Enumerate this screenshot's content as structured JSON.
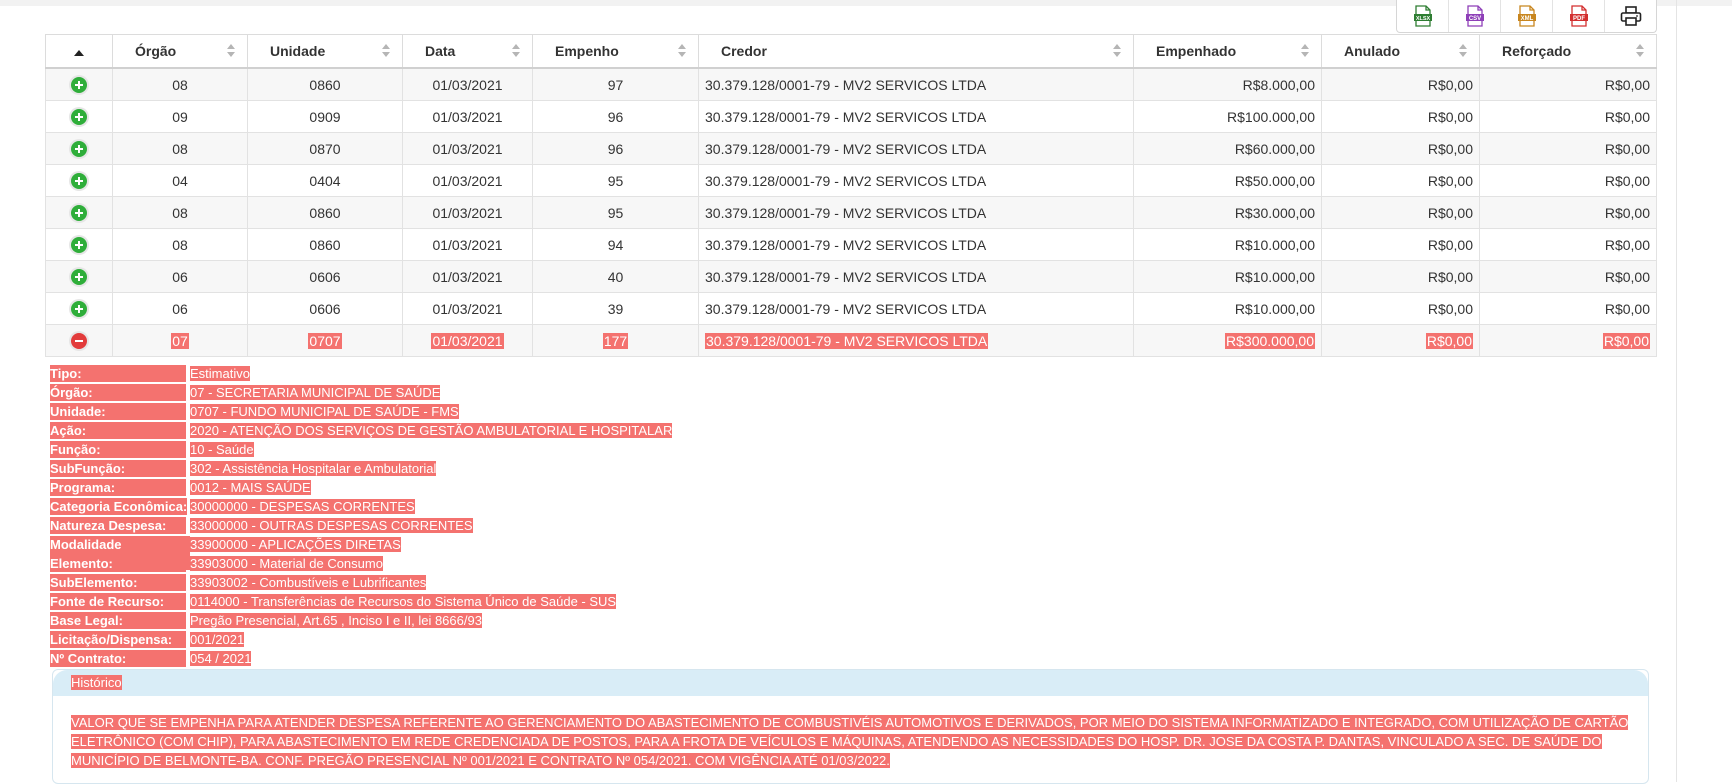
{
  "export_buttons": [
    {
      "label": "XLSX",
      "color": "#2e7d32"
    },
    {
      "label": "CSV",
      "color": "#8e3fb8"
    },
    {
      "label": "XML",
      "color": "#c8861f"
    },
    {
      "label": "PDF",
      "color": "#d32f2f"
    }
  ],
  "columns": [
    "Órgão",
    "Unidade",
    "Data",
    "Empenho",
    "Credor",
    "Empenhado",
    "Anulado",
    "Reforçado"
  ],
  "rows": [
    {
      "orgao": "08",
      "unidade": "0860",
      "data": "01/03/2021",
      "empenho": "97",
      "credor": "30.379.128/0001-79 - MV2 SERVICOS LTDA",
      "empenhado": "R$8.000,00",
      "anulado": "R$0,00",
      "reforcado": "R$0,00"
    },
    {
      "orgao": "09",
      "unidade": "0909",
      "data": "01/03/2021",
      "empenho": "96",
      "credor": "30.379.128/0001-79 - MV2 SERVICOS LTDA",
      "empenhado": "R$100.000,00",
      "anulado": "R$0,00",
      "reforcado": "R$0,00"
    },
    {
      "orgao": "08",
      "unidade": "0870",
      "data": "01/03/2021",
      "empenho": "96",
      "credor": "30.379.128/0001-79 - MV2 SERVICOS LTDA",
      "empenhado": "R$60.000,00",
      "anulado": "R$0,00",
      "reforcado": "R$0,00"
    },
    {
      "orgao": "04",
      "unidade": "0404",
      "data": "01/03/2021",
      "empenho": "95",
      "credor": "30.379.128/0001-79 - MV2 SERVICOS LTDA",
      "empenhado": "R$50.000,00",
      "anulado": "R$0,00",
      "reforcado": "R$0,00"
    },
    {
      "orgao": "08",
      "unidade": "0860",
      "data": "01/03/2021",
      "empenho": "95",
      "credor": "30.379.128/0001-79 - MV2 SERVICOS LTDA",
      "empenhado": "R$30.000,00",
      "anulado": "R$0,00",
      "reforcado": "R$0,00"
    },
    {
      "orgao": "08",
      "unidade": "0860",
      "data": "01/03/2021",
      "empenho": "94",
      "credor": "30.379.128/0001-79 - MV2 SERVICOS LTDA",
      "empenhado": "R$10.000,00",
      "anulado": "R$0,00",
      "reforcado": "R$0,00"
    },
    {
      "orgao": "06",
      "unidade": "0606",
      "data": "01/03/2021",
      "empenho": "40",
      "credor": "30.379.128/0001-79 - MV2 SERVICOS LTDA",
      "empenhado": "R$10.000,00",
      "anulado": "R$0,00",
      "reforcado": "R$0,00"
    },
    {
      "orgao": "06",
      "unidade": "0606",
      "data": "01/03/2021",
      "empenho": "39",
      "credor": "30.379.128/0001-79 - MV2 SERVICOS LTDA",
      "empenhado": "R$10.000,00",
      "anulado": "R$0,00",
      "reforcado": "R$0,00"
    },
    {
      "orgao": "07",
      "unidade": "0707",
      "data": "01/03/2021",
      "empenho": "177",
      "credor": "30.379.128/0001-79 - MV2 SERVICOS LTDA",
      "empenhado": "R$300.000,00",
      "anulado": "R$0,00",
      "reforcado": "R$0,00",
      "expanded": true
    }
  ],
  "details": [
    {
      "label": "Tipo:",
      "value": "Estimativo"
    },
    {
      "label": "Órgão:",
      "value": "07 - SECRETARIA MUNICIPAL DE SAÚDE"
    },
    {
      "label": "Unidade:",
      "value": "0707 - FUNDO MUNICIPAL DE SAÚDE - FMS"
    },
    {
      "label": "Ação:",
      "value": "2020 - ATENÇÃO DOS SERVIÇOS DE GESTÃO AMBULATORIAL E HOSPITALAR"
    },
    {
      "label": "Função:",
      "value": "10 - Saúde"
    },
    {
      "label": "SubFunção:",
      "value": "302 - Assistência Hospitalar e Ambulatorial"
    },
    {
      "label": "Programa:",
      "value": "0012 - MAIS SAÚDE"
    },
    {
      "label": "Categoria Econômica:",
      "value": "30000000 - DESPESAS CORRENTES"
    },
    {
      "label": "Natureza Despesa:",
      "value": "33000000 - OUTRAS DESPESAS CORRENTES"
    },
    {
      "label": "Modalidade Aplicação:",
      "value": "33900000 - APLICAÇÕES DIRETAS"
    },
    {
      "label": "Elemento:",
      "value": "33903000 - Material de Consumo"
    },
    {
      "label": "SubElemento:",
      "value": "33903002 - Combustíveis e Lubrificantes"
    },
    {
      "label": "Fonte de Recurso:",
      "value": "0114000 - Transferências de Recursos do Sistema Único de Saúde - SUS"
    },
    {
      "label": "Base Legal:",
      "value": "Pregão Presencial, Art.65 , Inciso I e II, lei 8666/93"
    },
    {
      "label": "Licitação/Dispensa:",
      "value": "001/2021"
    },
    {
      "label": "Nº Contrato:",
      "value": "054 / 2021"
    }
  ],
  "historico": {
    "title": "Histórico",
    "text": "VALOR QUE SE EMPENHA PARA ATENDER DESPESA REFERENTE AO GERENCIAMENTO DO ABASTECIMENTO DE COMBUSTIVÉIS AUTOMOTIVOS E DERIVADOS, POR MEIO DO SISTEMA INFORMATIZADO E INTEGRADO, COM UTILIZAÇÃO DE CARTÃO ELETRÔNICO (COM CHIP), PARA ABASTECIMENTO EM REDE CREDENCIADA DE POSTOS, PARA A FROTA DE VEÍCULOS E MÁQUINAS, ATENDENDO AS NECESSIDADES DO HOSP. DR. JOSE DA COSTA P. DANTAS, VINCULADO A SEC. DE SAÚDE DO MUNICÍPIO DE BELMONTE-BA. CONF. PREGÃO PRESENCIAL Nº 001/2021 E CONTRATO Nº 054/2021. COM VIGÊNCIA ATÉ 01/03/2022."
  },
  "highlight_color": "#f4726f"
}
